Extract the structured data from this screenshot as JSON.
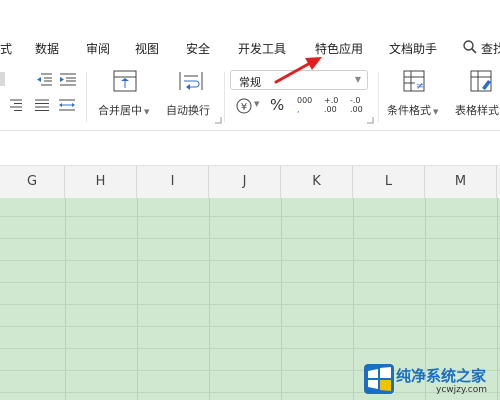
{
  "menu": {
    "items": [
      {
        "label": "式"
      },
      {
        "label": "数据"
      },
      {
        "label": "审阅"
      },
      {
        "label": "视图"
      },
      {
        "label": "安全"
      },
      {
        "label": "开发工具"
      },
      {
        "label": "特色应用"
      },
      {
        "label": "文档助手"
      },
      {
        "label": "查找"
      }
    ]
  },
  "ribbon": {
    "merge_center": "合并居中",
    "wrap_text": "自动换行",
    "number_format": "常规",
    "percent": "%",
    "thousands": "000",
    "decimal_increase": "+.0\n.00",
    "decimal_decrease": "-.0\n.00",
    "conditional_format": "条件格式",
    "table_style": "表格样式"
  },
  "columns": [
    "G",
    "H",
    "I",
    "J",
    "K",
    "L",
    "M"
  ],
  "watermark": {
    "title": "纯净系统之家",
    "url": "ycwjzy.com"
  },
  "colors": {
    "grid_fill": "#cfe8cf",
    "arrow": "#e02020",
    "accent": "#1a6fc0"
  }
}
